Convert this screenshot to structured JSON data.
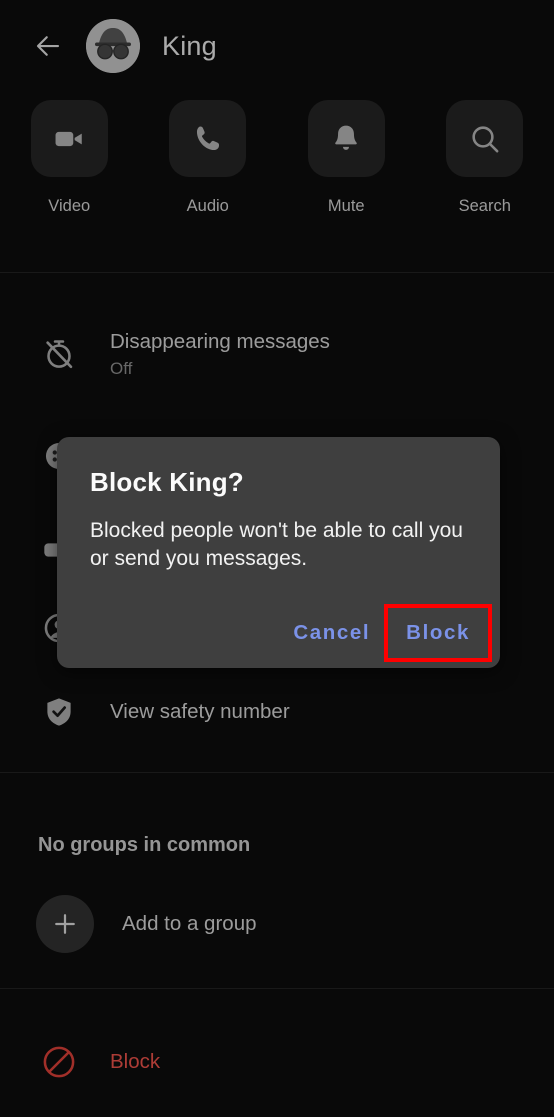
{
  "header": {
    "back_icon": "arrow-left-icon",
    "avatar_icon": "incognito-avatar-icon",
    "title": "King"
  },
  "quick_actions": [
    {
      "label": "Video",
      "icon": "video-camera-icon"
    },
    {
      "label": "Audio",
      "icon": "phone-icon"
    },
    {
      "label": "Mute",
      "icon": "bell-icon"
    },
    {
      "label": "Search",
      "icon": "search-icon"
    }
  ],
  "settings": {
    "disappearing_messages": {
      "title": "Disappearing messages",
      "value": "Off",
      "icon": "timer-off-icon"
    },
    "row_hidden_1": {
      "icon": "nickname-icon"
    },
    "row_hidden_2": {
      "icon": "chat-color-icon"
    },
    "row_hidden_3": {
      "icon": "contact-icon"
    },
    "view_safety_number": {
      "title": "View safety number",
      "icon": "shield-check-icon"
    }
  },
  "groups_section": {
    "heading": "No groups in common",
    "add_to_group": {
      "label": "Add to a group",
      "icon": "plus-icon"
    }
  },
  "block_section": {
    "label": "Block",
    "icon": "block-circle-icon",
    "color": "#f0544c"
  },
  "dialog": {
    "title": "Block King?",
    "message": "Blocked people won't be able to call you or send you messages.",
    "cancel_label": "Cancel",
    "confirm_label": "Block",
    "accent_color": "#7b92e8",
    "highlight_color": "#ff0000",
    "background": "#3f3f3f"
  }
}
